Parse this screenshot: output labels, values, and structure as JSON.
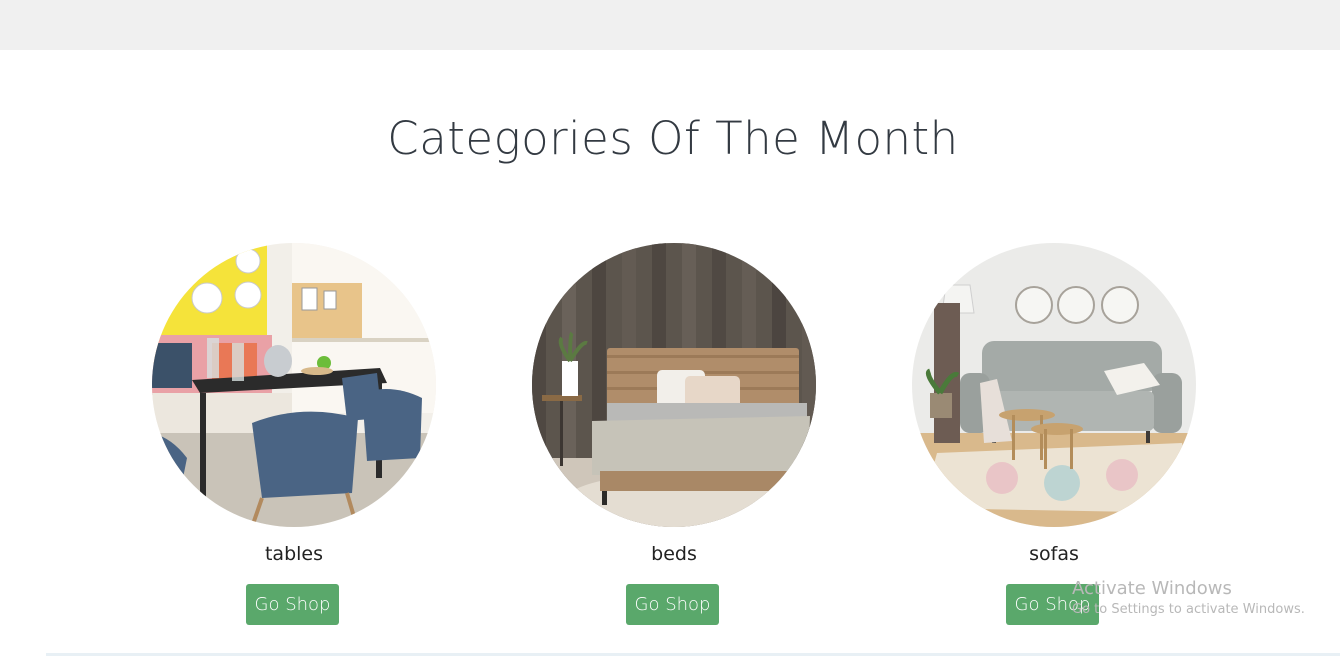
{
  "section": {
    "title": "Categories Of The Month"
  },
  "categories": [
    {
      "label": "tables",
      "button": "Go Shop",
      "icon": "dining-table-photo"
    },
    {
      "label": "beds",
      "button": "Go Shop",
      "icon": "bed-photo"
    },
    {
      "label": "sofas",
      "button": "Go Shop",
      "icon": "sofa-photo"
    }
  ],
  "watermark": {
    "line1": "Activate Windows",
    "line2": "Go to Settings to activate Windows."
  },
  "colors": {
    "button": "#5aa86b",
    "title": "#333a42",
    "topbar": "#f0f0f0"
  }
}
